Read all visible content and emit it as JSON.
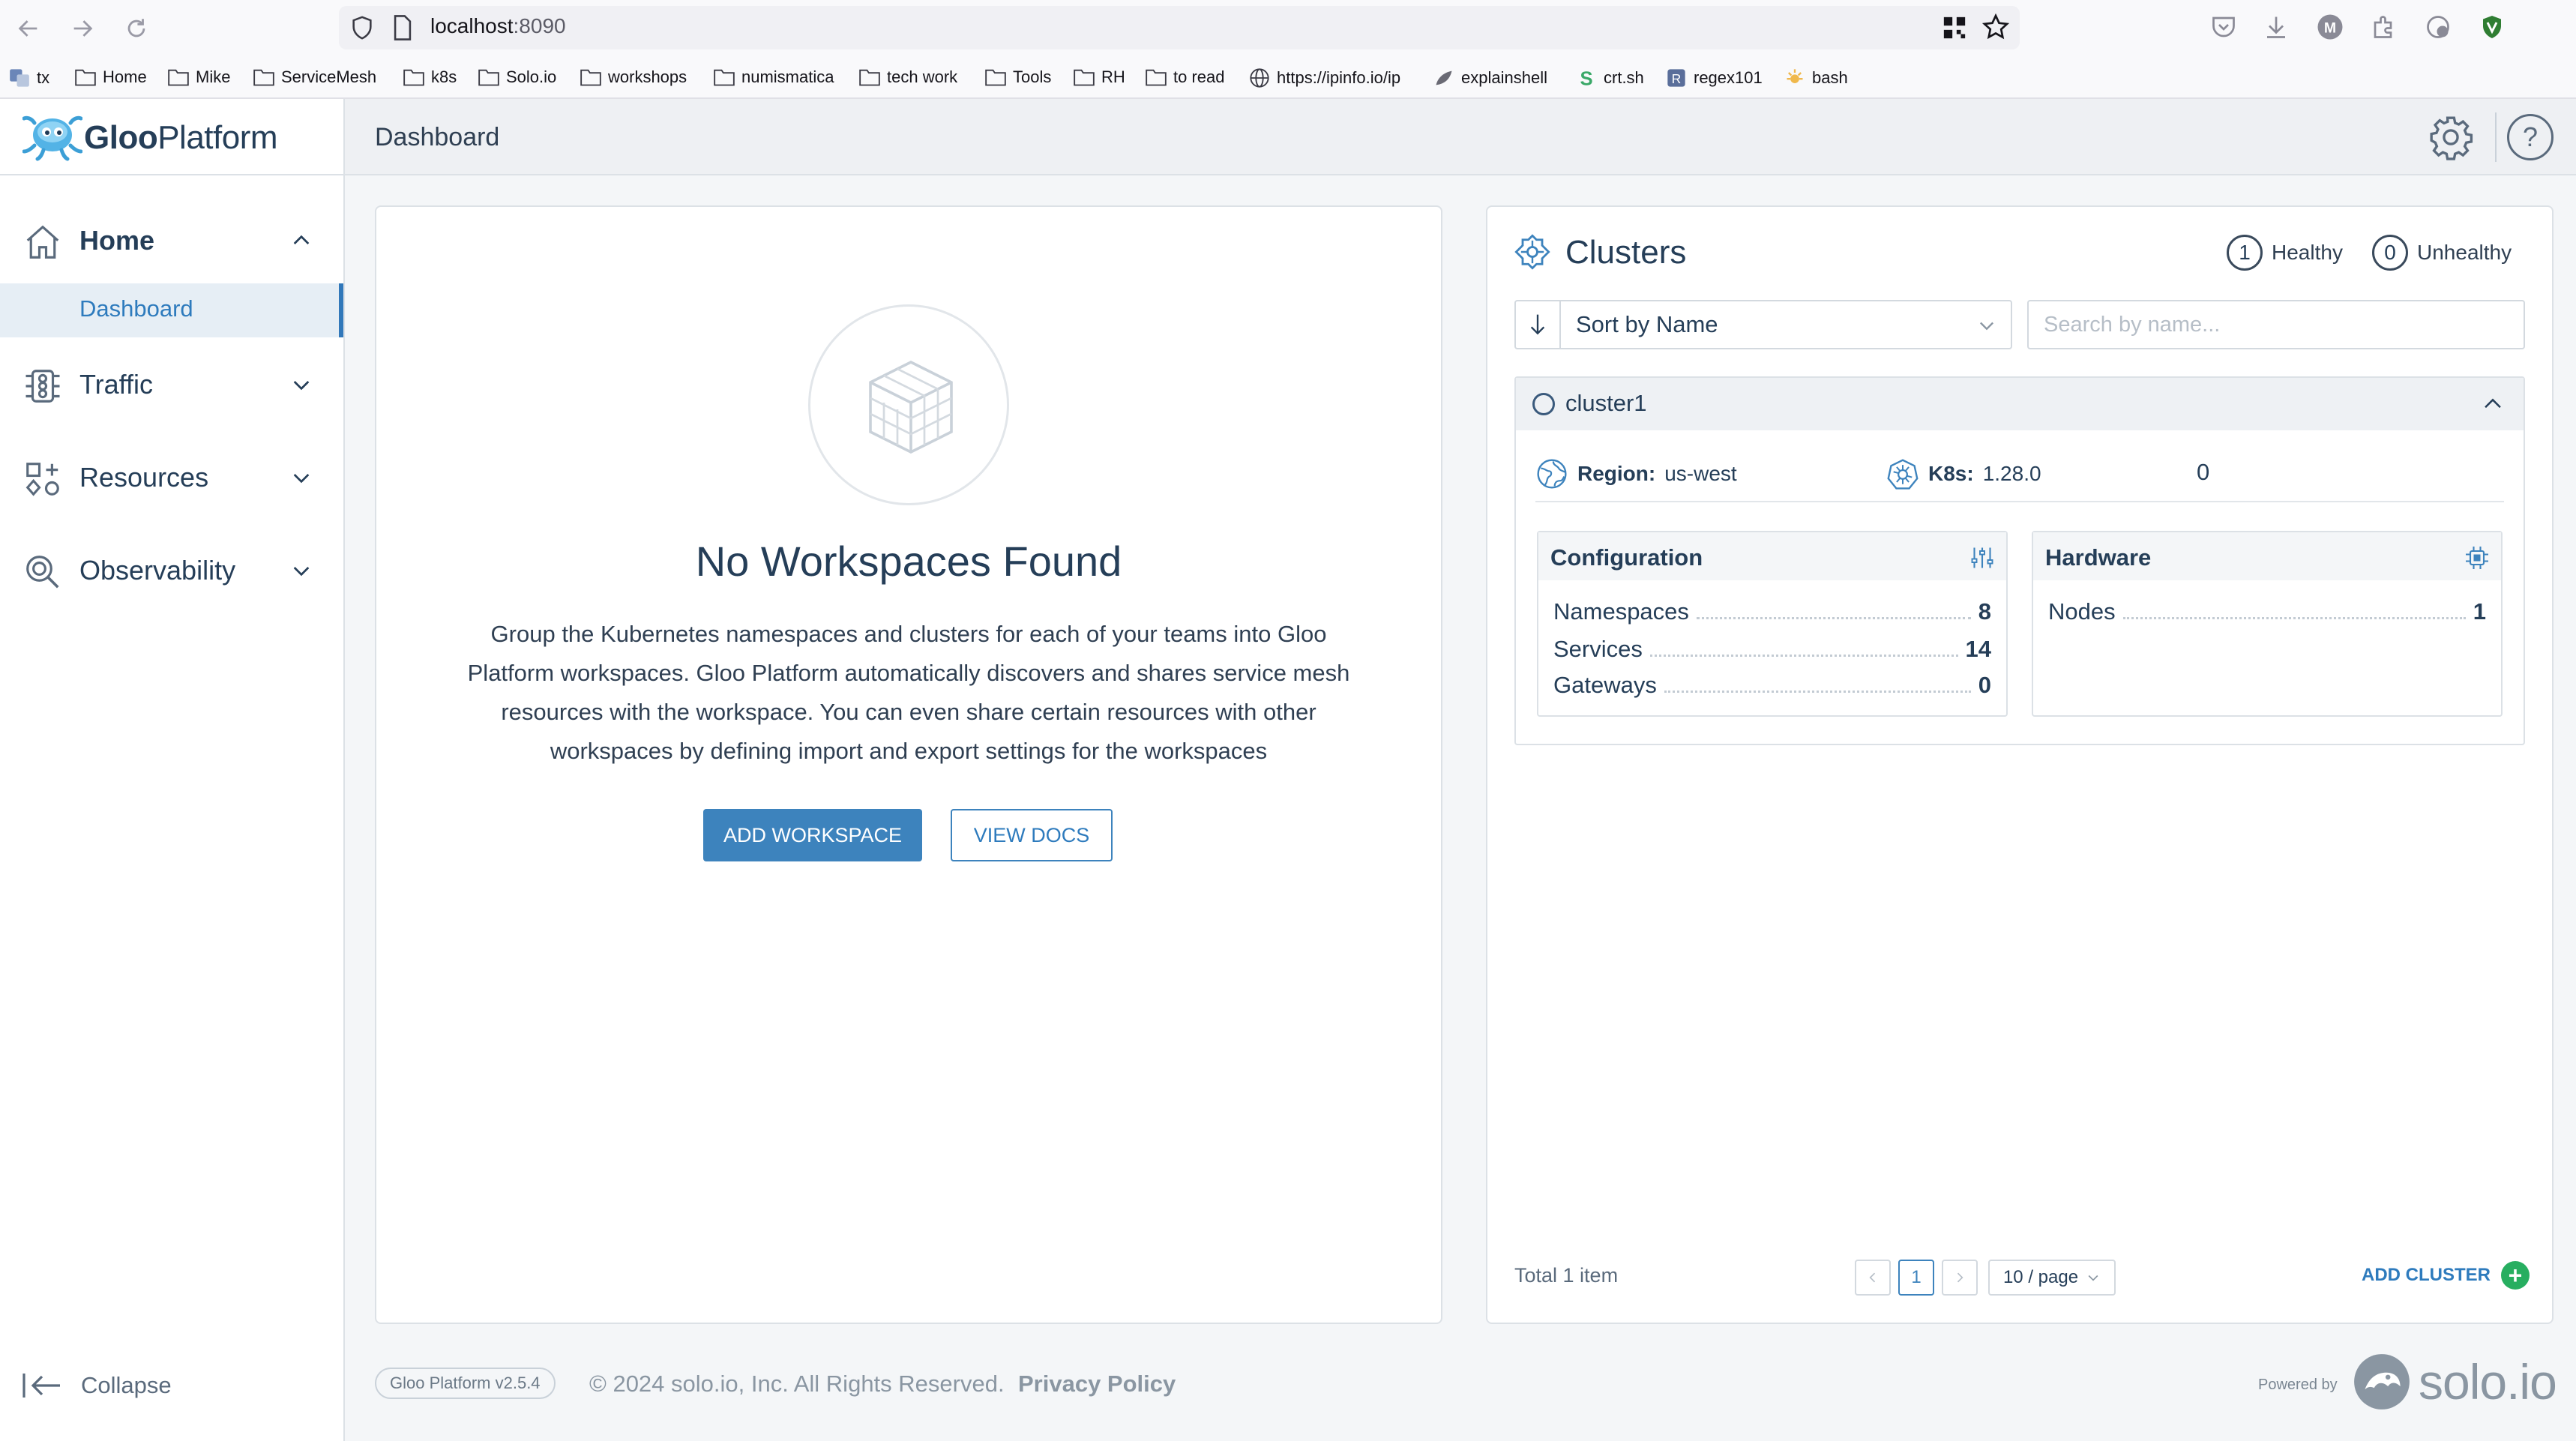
{
  "browser": {
    "url_host": "localhost",
    "url_port": ":8090",
    "bookmarks": [
      {
        "label": "tx",
        "icon": "translate-icon"
      },
      {
        "label": "Home",
        "icon": "folder-icon"
      },
      {
        "label": "Mike",
        "icon": "folder-icon"
      },
      {
        "label": "ServiceMesh",
        "icon": "folder-icon"
      },
      {
        "label": "k8s",
        "icon": "folder-icon"
      },
      {
        "label": "Solo.io",
        "icon": "folder-icon"
      },
      {
        "label": "workshops",
        "icon": "folder-icon"
      },
      {
        "label": "numismatica",
        "icon": "folder-icon"
      },
      {
        "label": "tech work",
        "icon": "folder-icon"
      },
      {
        "label": "Tools",
        "icon": "folder-icon"
      },
      {
        "label": "RH",
        "icon": "folder-icon"
      },
      {
        "label": "to read",
        "icon": "folder-icon"
      },
      {
        "label": "https://ipinfo.io/ip",
        "icon": "globe-icon"
      },
      {
        "label": "explainshell",
        "icon": "shell-icon"
      },
      {
        "label": "crt.sh",
        "icon": "crt-icon"
      },
      {
        "label": "regex101",
        "icon": "regex-icon"
      },
      {
        "label": "bash",
        "icon": "bash-icon"
      }
    ]
  },
  "app": {
    "logo_bold": "Gloo",
    "logo_rest": "Platform",
    "page_title": "Dashboard"
  },
  "sidebar": {
    "home": {
      "label": "Home",
      "icon": "home-icon"
    },
    "home_children": [
      {
        "label": "Dashboard"
      }
    ],
    "traffic": {
      "label": "Traffic",
      "icon": "traffic-icon"
    },
    "resources": {
      "label": "Resources",
      "icon": "resources-icon"
    },
    "observability": {
      "label": "Observability",
      "icon": "observability-icon"
    },
    "collapse_label": "Collapse"
  },
  "workspaces": {
    "title": "No Workspaces Found",
    "description": "Group the Kubernetes namespaces and clusters for each of your teams into Gloo Platform workspaces. Gloo Platform automatically discovers and shares service mesh resources with the workspace. You can even share certain resources with other workspaces by defining import and export settings for the workspaces",
    "add_button": "ADD WORKSPACE",
    "docs_button": "VIEW DOCS"
  },
  "clusters": {
    "title": "Clusters",
    "healthy_count": "1",
    "healthy_label": "Healthy",
    "unhealthy_count": "0",
    "unhealthy_label": "Unhealthy",
    "sort_label": "Sort by Name",
    "search_placeholder": "Search by name...",
    "items": [
      {
        "name": "cluster1",
        "region_label": "Region:",
        "region_value": "us-west",
        "k8s_label": "K8s:",
        "k8s_value": "1.28.0",
        "extra_count": "0",
        "configuration": {
          "title": "Configuration",
          "rows": [
            {
              "label": "Namespaces",
              "value": "8"
            },
            {
              "label": "Services",
              "value": "14"
            },
            {
              "label": "Gateways",
              "value": "0"
            }
          ]
        },
        "hardware": {
          "title": "Hardware",
          "rows": [
            {
              "label": "Nodes",
              "value": "1"
            }
          ]
        }
      }
    ],
    "total_label": "Total 1 item",
    "current_page": "1",
    "page_size": "10 / page",
    "add_cluster_label": "ADD CLUSTER"
  },
  "footer": {
    "version": "Gloo Platform v2.5.4",
    "copyright": "© 2024 solo.io, Inc. All Rights Reserved.",
    "privacy": "Privacy Policy",
    "powered_by": "Powered by",
    "brand": "solo.io"
  },
  "colors": {
    "accent": "#3d83bd",
    "text_primary": "#253e58",
    "success": "#27ae60",
    "sidebar_active_bg": "#e6eef5"
  }
}
